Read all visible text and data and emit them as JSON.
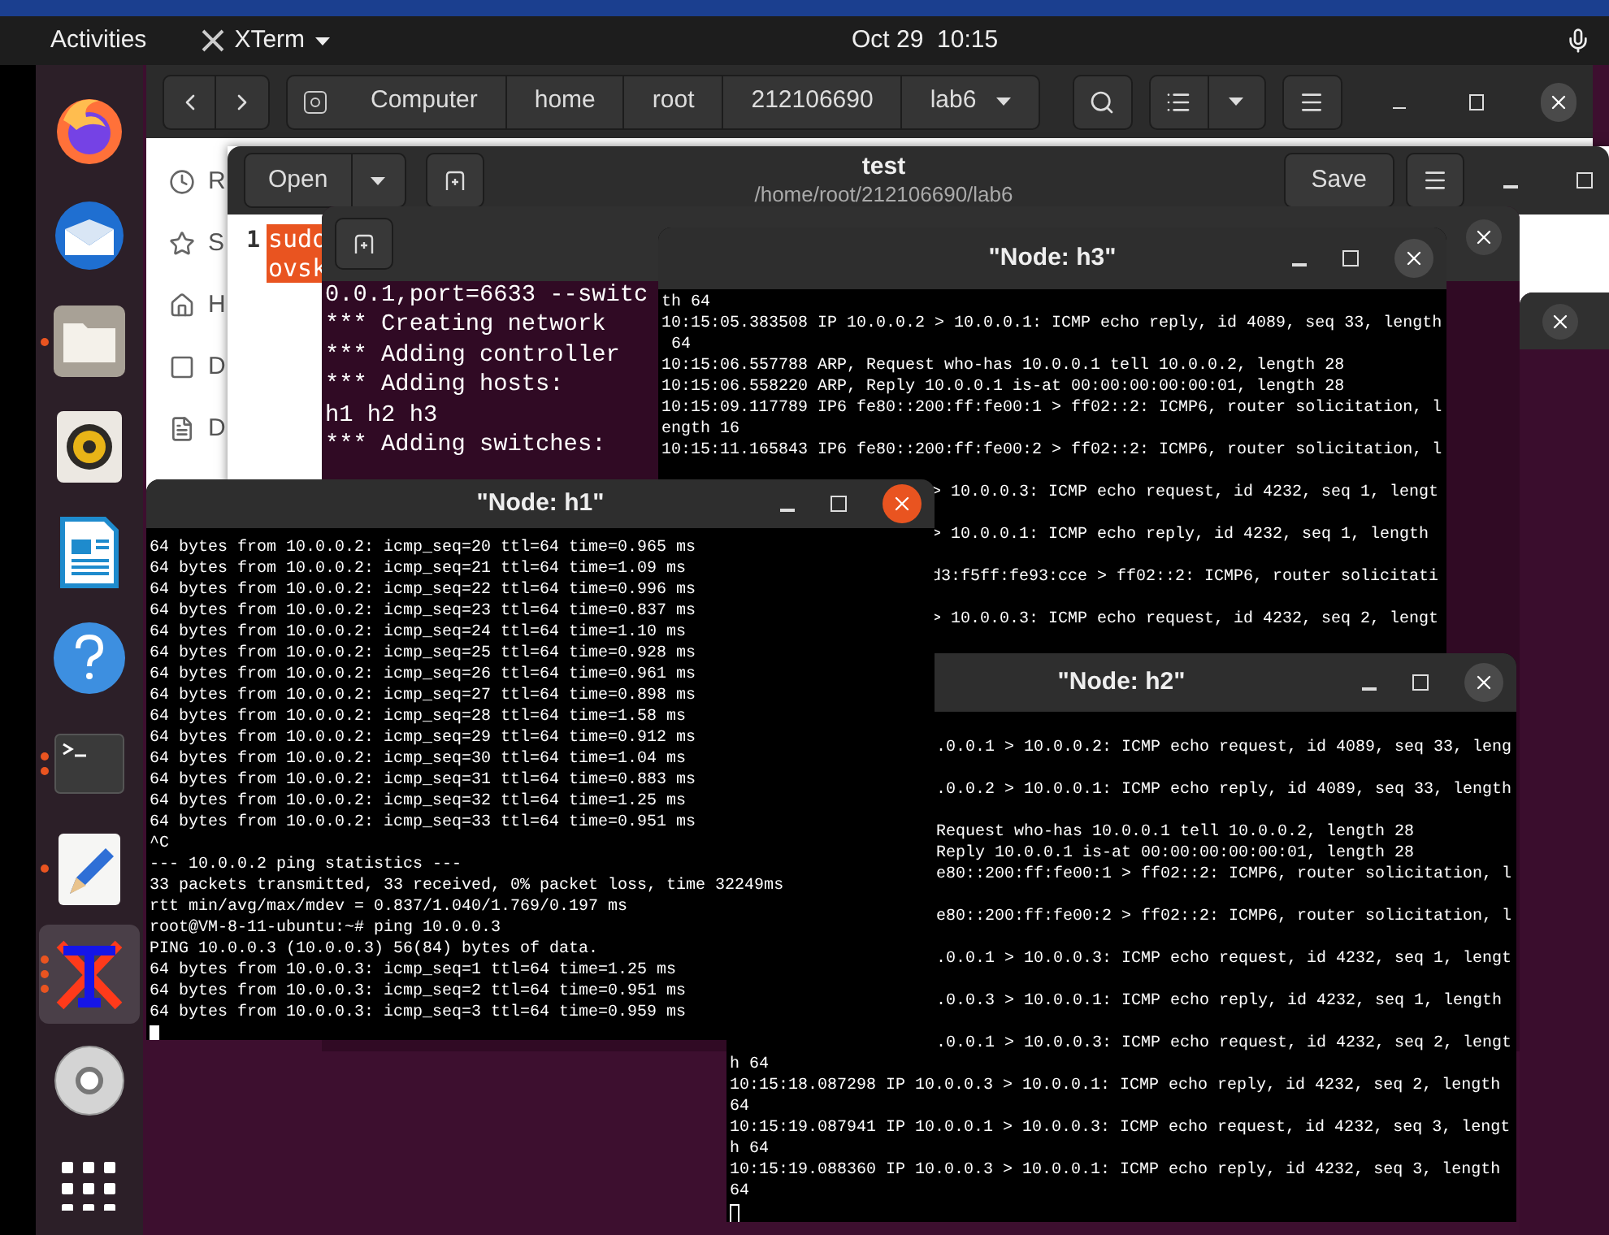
{
  "top_bar": {
    "activities": "Activities",
    "app_menu": "XTerm",
    "clock": "Oct 29  10:15"
  },
  "dock": {
    "items": [
      {
        "kind": "browser",
        "selected": false
      },
      {
        "kind": "mail",
        "selected": false
      },
      {
        "kind": "files",
        "selected": false,
        "windows": [
          {
            "open": true
          }
        ]
      },
      {
        "kind": "audio",
        "selected": false
      },
      {
        "kind": "writer",
        "selected": false
      },
      {
        "kind": "help",
        "selected": false
      },
      {
        "kind": "terminal",
        "selected": false,
        "windows": [
          {
            "open": true
          },
          {
            "open": true
          }
        ]
      },
      {
        "kind": "editor",
        "selected": false,
        "windows": [
          {
            "open": true
          }
        ]
      },
      {
        "kind": "xterm",
        "selected": true,
        "windows": [
          {
            "open": true
          },
          {
            "open": true
          },
          {
            "open": true
          }
        ]
      },
      {
        "kind": "disc",
        "selected": false
      },
      {
        "kind": "apps",
        "selected": false
      }
    ]
  },
  "file_manager": {
    "path": [
      "Computer",
      "home",
      "root",
      "212106690",
      "lab6"
    ],
    "sidebar": [
      {
        "kind": "recent",
        "label": "R"
      },
      {
        "kind": "starred",
        "label": "S"
      },
      {
        "kind": "home",
        "label": "H"
      },
      {
        "kind": "desktop",
        "label": "D"
      },
      {
        "kind": "documents",
        "label": "D"
      }
    ]
  },
  "editor": {
    "open_button": "Open",
    "title": "test",
    "subtitle": "/home/root/212106690/lab6",
    "save_button": "Save",
    "line_number": "1",
    "lines": [
      "sudo",
      "ovsk"
    ]
  },
  "terminal": {
    "lines": [
      "0.0.1,port=6633 --switc",
      "*** Creating network",
      "*** Adding controller",
      "*** Adding hosts:",
      "h1 h2 h3",
      "*** Adding switches:"
    ]
  },
  "xterm_windows": [
    {
      "title": "\"Node: h3\"",
      "focused": false,
      "lines": [
        {
          "kind": "full",
          "text": "th 64"
        },
        {
          "kind": "full",
          "text": "10:15:05.383508 IP 10.0.0.2 > 10.0.0.1: ICMP echo reply, id 4089, seq 33, length"
        },
        {
          "kind": "full",
          "text": " 64"
        },
        {
          "kind": "full",
          "text": "10:15:06.557788 ARP, Request who-has 10.0.0.1 tell 10.0.0.2, length 28"
        },
        {
          "kind": "full",
          "text": "10:15:06.558220 ARP, Reply 10.0.0.1 is-at 00:00:00:00:00:01, length 28"
        },
        {
          "kind": "full",
          "text": "10:15:09.117789 IP6 fe80::200:ff:fe00:1 > ff02::2: ICMP6, router solicitation, l"
        },
        {
          "kind": "full",
          "text": "ength 16"
        },
        {
          "kind": "full",
          "text": "10:15:11.165843 IP6 fe80::200:ff:fe00:2 > ff02::2: ICMP6, router solicitation, l"
        },
        {
          "kind": "cut_gap",
          "text": "> 10.0.0.3: ICMP echo request, id 4232, seq 1, lengt"
        },
        {
          "kind": "cut_gap",
          "text": "> 10.0.0.1: ICMP echo reply, id 4232, seq 1, length"
        },
        {
          "kind": "cut_gap",
          "text": "d3:f5ff:fe93:cce > ff02::2: ICMP6, router solicitati"
        },
        {
          "kind": "cut_gap",
          "text": "> 10.0.0.3: ICMP echo request, id 4232, seq 2, lengt"
        }
      ]
    },
    {
      "title": "\"Node: h1\"",
      "focused": true,
      "cursor_filled": true,
      "lines": [
        {
          "kind": "full",
          "text": "64 bytes from 10.0.0.2: icmp_seq=20 ttl=64 time=0.965 ms"
        },
        {
          "kind": "full",
          "text": "64 bytes from 10.0.0.2: icmp_seq=21 ttl=64 time=1.09 ms"
        },
        {
          "kind": "full",
          "text": "64 bytes from 10.0.0.2: icmp_seq=22 ttl=64 time=0.996 ms"
        },
        {
          "kind": "full",
          "text": "64 bytes from 10.0.0.2: icmp_seq=23 ttl=64 time=0.837 ms"
        },
        {
          "kind": "full",
          "text": "64 bytes from 10.0.0.2: icmp_seq=24 ttl=64 time=1.10 ms"
        },
        {
          "kind": "full",
          "text": "64 bytes from 10.0.0.2: icmp_seq=25 ttl=64 time=0.928 ms"
        },
        {
          "kind": "full",
          "text": "64 bytes from 10.0.0.2: icmp_seq=26 ttl=64 time=0.961 ms"
        },
        {
          "kind": "full",
          "text": "64 bytes from 10.0.0.2: icmp_seq=27 ttl=64 time=0.898 ms"
        },
        {
          "kind": "full",
          "text": "64 bytes from 10.0.0.2: icmp_seq=28 ttl=64 time=1.58 ms"
        },
        {
          "kind": "full",
          "text": "64 bytes from 10.0.0.2: icmp_seq=29 ttl=64 time=0.912 ms"
        },
        {
          "kind": "full",
          "text": "64 bytes from 10.0.0.2: icmp_seq=30 ttl=64 time=1.04 ms"
        },
        {
          "kind": "full",
          "text": "64 bytes from 10.0.0.2: icmp_seq=31 ttl=64 time=0.883 ms"
        },
        {
          "kind": "full",
          "text": "64 bytes from 10.0.0.2: icmp_seq=32 ttl=64 time=1.25 ms"
        },
        {
          "kind": "full",
          "text": "64 bytes from 10.0.0.2: icmp_seq=33 ttl=64 time=0.951 ms"
        },
        {
          "kind": "full",
          "text": "^C"
        },
        {
          "kind": "full",
          "text": "--- 10.0.0.2 ping statistics ---"
        },
        {
          "kind": "full",
          "text": "33 packets transmitted, 33 received, 0% packet loss, time 32249ms"
        },
        {
          "kind": "full",
          "text": "rtt min/avg/max/mdev = 0.837/1.040/1.769/0.197 ms"
        },
        {
          "kind": "full",
          "text": "root@VM-8-11-ubuntu:~# ping 10.0.0.3"
        },
        {
          "kind": "full",
          "text": "PING 10.0.0.3 (10.0.0.3) 56(84) bytes of data."
        },
        {
          "kind": "full",
          "text": "64 bytes from 10.0.0.3: icmp_seq=1 ttl=64 time=1.25 ms"
        },
        {
          "kind": "full",
          "text": "64 bytes from 10.0.0.3: icmp_seq=2 ttl=64 time=0.951 ms"
        },
        {
          "kind": "full",
          "text": "64 bytes from 10.0.0.3: icmp_seq=3 ttl=64 time=0.959 ms"
        }
      ]
    },
    {
      "title": "\"Node: h2\"",
      "focused": false,
      "cursor_filled": false,
      "lines": [
        {
          "kind": "cut_gap",
          "text": ".0.0.1 > 10.0.0.2: ICMP echo request, id 4089, seq 33, leng"
        },
        {
          "kind": "cut_gap",
          "text": ".0.0.2 > 10.0.0.1: ICMP echo reply, id 4089, seq 33, length"
        },
        {
          "kind": "cut_gap",
          "text": "Request who-has 10.0.0.1 tell 10.0.0.2, length 28"
        },
        {
          "kind": "cut",
          "text": "Reply 10.0.0.1 is-at 00:00:00:00:00:01, length 28"
        },
        {
          "kind": "cut",
          "text": "e80::200:ff:fe00:1 > ff02::2: ICMP6, router solicitation, l"
        },
        {
          "kind": "cut_gap",
          "text": "e80::200:ff:fe00:2 > ff02::2: ICMP6, router solicitation, l"
        },
        {
          "kind": "cut_gap",
          "text": ".0.0.1 > 10.0.0.3: ICMP echo request, id 4232, seq 1, lengt"
        },
        {
          "kind": "cut_gap",
          "text": ".0.0.3 > 10.0.0.1: ICMP echo reply, id 4232, seq 1, length"
        },
        {
          "kind": "cut_gap",
          "text": ".0.0.1 > 10.0.0.3: ICMP echo request, id 4232, seq 2, lengt"
        },
        {
          "kind": "full",
          "text": "h 64"
        },
        {
          "kind": "full",
          "text": "10:15:18.087298 IP 10.0.0.3 > 10.0.0.1: ICMP echo reply, id 4232, seq 2, length"
        },
        {
          "kind": "full",
          "text": "64"
        },
        {
          "kind": "full",
          "text": "10:15:19.087941 IP 10.0.0.1 > 10.0.0.3: ICMP echo request, id 4232, seq 3, lengt"
        },
        {
          "kind": "full",
          "text": "h 64"
        },
        {
          "kind": "full",
          "text": "10:15:19.088360 IP 10.0.0.3 > 10.0.0.1: ICMP echo reply, id 4232, seq 3, length"
        },
        {
          "kind": "full",
          "text": "64"
        }
      ]
    }
  ]
}
